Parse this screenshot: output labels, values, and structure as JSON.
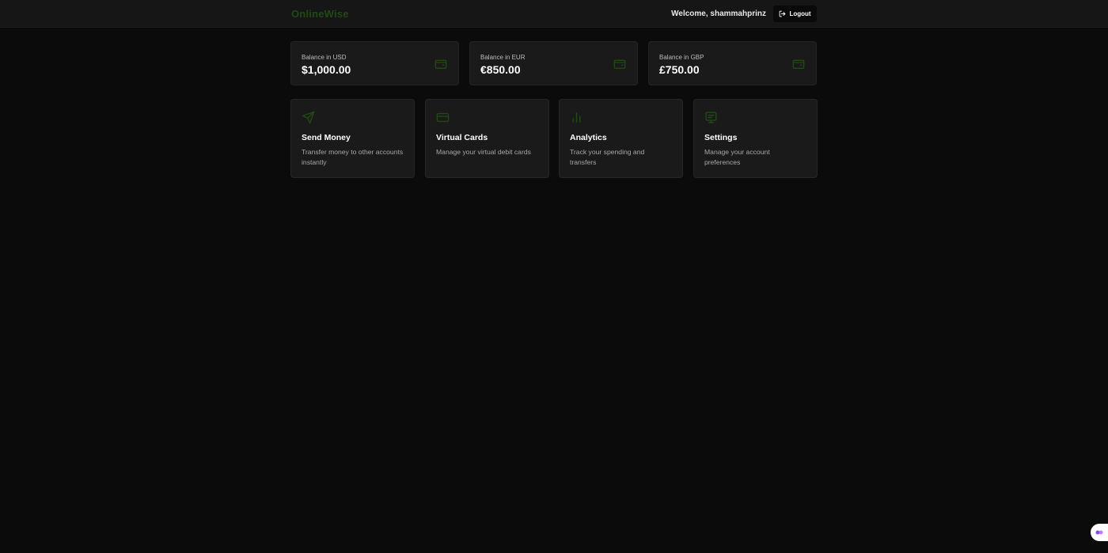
{
  "header": {
    "brand": "OnlineWise",
    "welcome": "Welcome, shammahprinz",
    "logout_label": "Logout"
  },
  "balances": [
    {
      "label": "Balance in USD",
      "value": "$1,000.00",
      "icon": "wallet-icon"
    },
    {
      "label": "Balance in EUR",
      "value": "€850.00",
      "icon": "wallet-icon"
    },
    {
      "label": "Balance in GBP",
      "value": "£750.00",
      "icon": "wallet-icon"
    }
  ],
  "features": [
    {
      "title": "Send Money",
      "description": "Transfer money to other accounts instantly",
      "icon": "send-icon"
    },
    {
      "title": "Virtual Cards",
      "description": "Manage your virtual debit cards",
      "icon": "credit-card-icon"
    },
    {
      "title": "Analytics",
      "description": "Track your spending and transfers",
      "icon": "bar-chart-icon"
    },
    {
      "title": "Settings",
      "description": "Manage your account preferences",
      "icon": "settings-icon"
    }
  ],
  "colors": {
    "accent": "#1f4a14",
    "background": "#0b0b0b",
    "card": "#1a1a1a",
    "header": "#161616"
  }
}
